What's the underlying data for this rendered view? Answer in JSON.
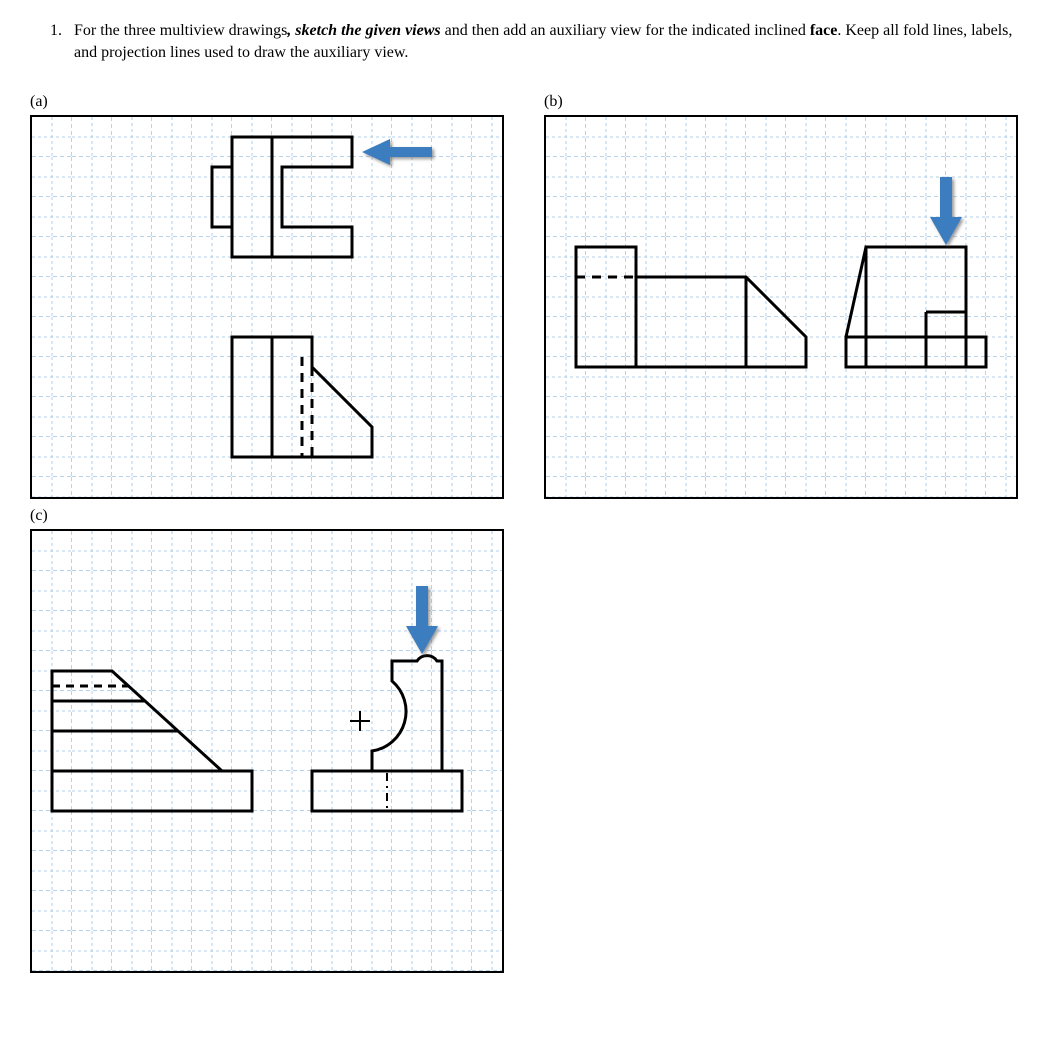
{
  "question": {
    "number": "1.",
    "text_before_bold1": "For the three multiview drawings",
    "bold_italic1": ", sketch the given views",
    "text_mid": " and then add an auxiliary view for the indicated inclined ",
    "bold2": "face",
    "text_after": ".  Keep all fold lines, labels, and projection lines used to draw the auxiliary view."
  },
  "parts": {
    "a": "(a)",
    "b": "(b)",
    "c": "(c)"
  },
  "colors": {
    "grid_minor": "#9dc3e6",
    "grid_major": "#6fa8dc",
    "arrow": "#3b7dbf",
    "arrow_shadow": "#6b6b6b",
    "stroke": "#000000"
  }
}
